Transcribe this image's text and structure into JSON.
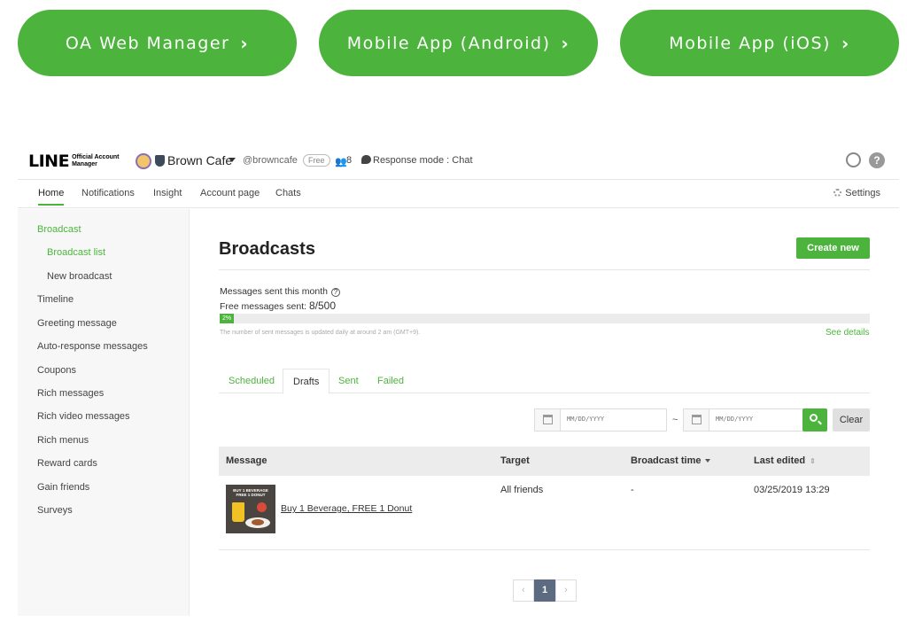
{
  "top_links": [
    {
      "label": "OA Web Manager",
      "chevron": "›"
    },
    {
      "label": "Mobile App (Android)",
      "chevron": "›"
    },
    {
      "label": "Mobile App (iOS)",
      "chevron": "›"
    }
  ],
  "header": {
    "logo_main": "LINE",
    "logo_sub_1": "Official Account",
    "logo_sub_2": "Manager",
    "account_name": "Brown Cafe",
    "account_id": "@browncafe",
    "plan_badge": "Free",
    "friends_icon": "👥",
    "friends_count": "8",
    "response_mode": "Response mode : Chat",
    "help_glyph": "?"
  },
  "nav": {
    "items": [
      "Home",
      "Notifications",
      "Insight",
      "Account page",
      "Chats"
    ],
    "settings_label": "Settings"
  },
  "sidebar": {
    "items": [
      {
        "label": "Broadcast"
      },
      {
        "label": "Broadcast list"
      },
      {
        "label": "New broadcast"
      },
      {
        "label": "Timeline"
      },
      {
        "label": "Greeting message"
      },
      {
        "label": "Auto-response messages"
      },
      {
        "label": "Coupons"
      },
      {
        "label": "Rich messages"
      },
      {
        "label": "Rich video messages"
      },
      {
        "label": "Rich menus"
      },
      {
        "label": "Reward cards"
      },
      {
        "label": "Gain friends"
      },
      {
        "label": "Surveys"
      }
    ]
  },
  "main": {
    "title": "Broadcasts",
    "create_label": "Create new",
    "messages_sent_label": "Messages sent this month",
    "help_glyph": "?",
    "free_sent_label": "Free messages sent: ",
    "free_sent_value": "8/500",
    "progress_percent": 2,
    "progress_label": "2%",
    "update_note": "The number of sent messages is updated daily at around 2 am (GMT+9).",
    "see_details": "See details",
    "tabs": [
      "Scheduled",
      "Drafts",
      "Sent",
      "Failed"
    ],
    "active_tab": "Drafts",
    "date_placeholder": "MM/DD/YYYY",
    "tilde": "~",
    "clear_label": "Clear",
    "columns": [
      "Message",
      "Target",
      "Broadcast time",
      "Last edited"
    ],
    "sort_both_glyph": "⇕",
    "rows": [
      {
        "thumb_text_1": "BUY 1 BEVERAGE",
        "thumb_text_2": "FREE 1 DONUT",
        "message": "Buy 1 Beverage, FREE 1 Donut",
        "target": "All friends",
        "broadcast_time": "-",
        "last_edited": "03/25/2019 13:29"
      }
    ],
    "pager": {
      "prev": "‹",
      "current": "1",
      "next": "›"
    }
  },
  "colors": {
    "brand_green": "#4cb43c",
    "pager_active": "#5c6a82"
  }
}
